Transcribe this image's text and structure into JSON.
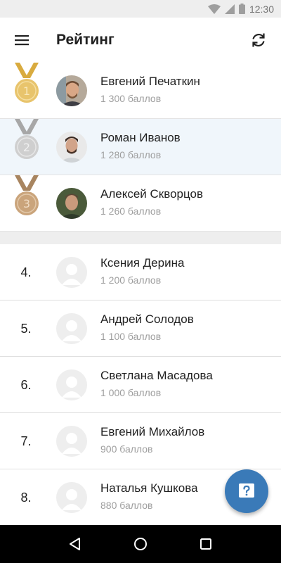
{
  "status_bar": {
    "time": "12:30"
  },
  "app_bar": {
    "title": "Рейтинг"
  },
  "top": [
    {
      "place": "1",
      "medal": "gold",
      "name": "Евгений Печаткин",
      "score": "1 300 баллов",
      "highlight": false
    },
    {
      "place": "2",
      "medal": "silver",
      "name": "Роман Иванов",
      "score": "1 280 баллов",
      "highlight": true
    },
    {
      "place": "3",
      "medal": "bronze",
      "name": "Алексей Скворцов",
      "score": "1 260 баллов",
      "highlight": false
    }
  ],
  "rest": [
    {
      "rank": "4.",
      "name": "Ксения Дерина",
      "score": "1 200 баллов"
    },
    {
      "rank": "5.",
      "name": "Андрей Солодов",
      "score": "1 100 баллов"
    },
    {
      "rank": "6.",
      "name": "Светлана Масадова",
      "score": "1 000 баллов"
    },
    {
      "rank": "7.",
      "name": "Евгений Михайлов",
      "score": "900 баллов"
    },
    {
      "rank": "8.",
      "name": "Наталья Кушкова",
      "score": "880 баллов"
    }
  ],
  "fab": {
    "icon": "help-icon"
  },
  "colors": {
    "accent": "#3a7ab8",
    "gold": "#e2bd63",
    "silver": "#cfcfcf",
    "bronze": "#c9a27a"
  }
}
